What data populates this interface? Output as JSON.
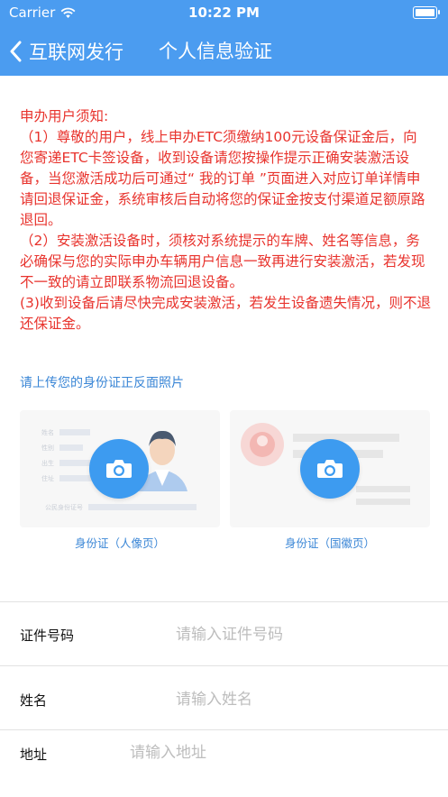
{
  "status": {
    "carrier": "Carrier",
    "time": "10:22 PM"
  },
  "nav": {
    "back_label": "互联网发行",
    "title": "个人信息验证"
  },
  "notice": {
    "heading": "申办用户须知:",
    "item1": "（1）尊敬的用户，线上申办ETC须缴纳100元设备保证金后，向您寄递ETC卡签设备，收到设备请您按操作提示正确安装激活设备，当您激活成功后可通过“ 我的订单 ”页面进入对应订单详情申请回退保证金，系统审核后自动将您的保证金按支付渠道足额原路退回。",
    "item2": "（2）安装激活设备时，须核对系统提示的车牌、姓名等信息，务必确保与您的实际申办车辆用户信息一致再进行安装激活，若发现不一致的请立即联系物流回退设备。",
    "item3": "(3)收到设备后请尽快完成安装激活，若发生设备遗失情况，则不退还保证金。"
  },
  "upload": {
    "hint": "请上传您的身份证正反面照片",
    "front_caption": "身份证（人像页）",
    "back_caption": "身份证（国徽页）",
    "front_card_fields": [
      "姓名",
      "性别",
      "出生",
      "住址",
      "公民身份证号"
    ]
  },
  "form": {
    "id_label": "证件号码",
    "id_placeholder": "请输入证件号码",
    "name_label": "姓名",
    "name_placeholder": "请输入姓名",
    "address_label": "地址",
    "address_placeholder": "请输入地址"
  },
  "colors": {
    "primary": "#4b9cf0",
    "notice_red": "#e8332d",
    "link_blue": "#3a86d6"
  }
}
